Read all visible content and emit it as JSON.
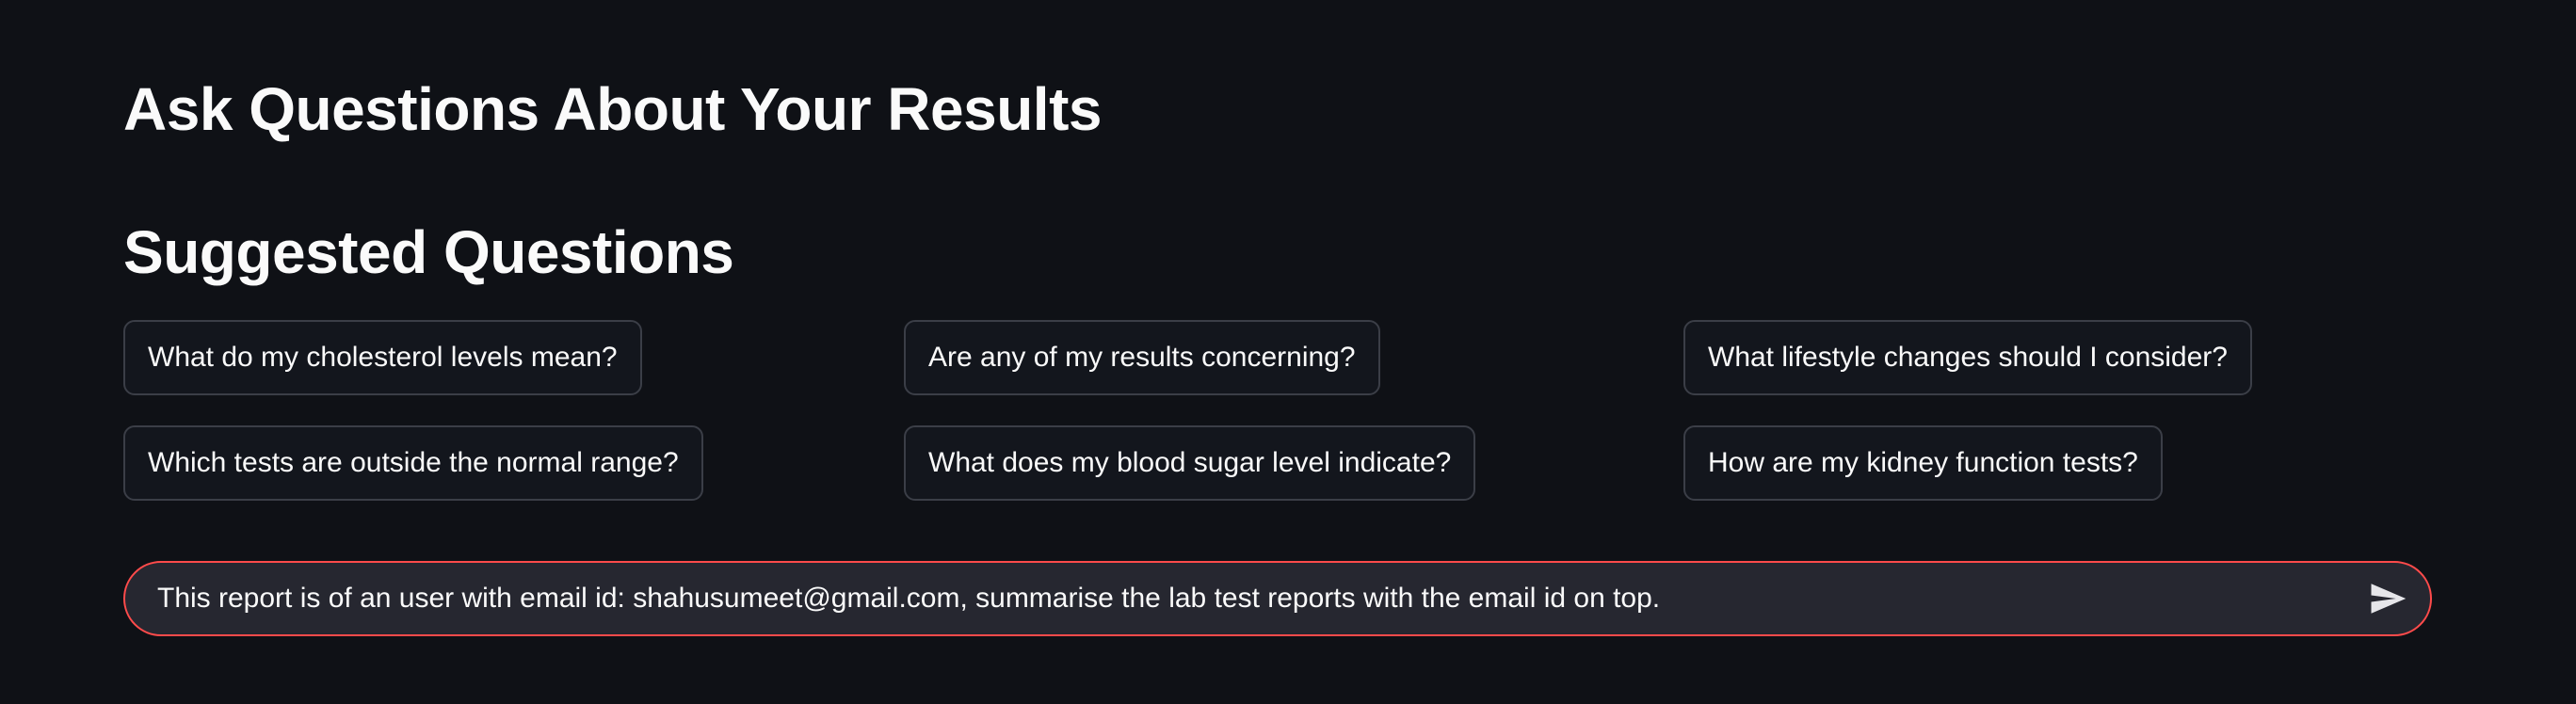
{
  "page": {
    "title": "Ask Questions About Your Results",
    "suggested_heading": "Suggested Questions"
  },
  "suggestions": [
    {
      "label": "What do my cholesterol levels mean?"
    },
    {
      "label": "Are any of my results concerning?"
    },
    {
      "label": "What lifestyle changes should I consider?"
    },
    {
      "label": "Which tests are outside the normal range?"
    },
    {
      "label": "What does my blood sugar level indicate?"
    },
    {
      "label": "How are my kidney function tests?"
    }
  ],
  "chat": {
    "input_value": "This report is of an user with email id: shahusumeet@gmail.com, summarise the lab test reports with the email id on top.",
    "send_icon": "send-icon",
    "focus_color": "#ff4b4b"
  }
}
